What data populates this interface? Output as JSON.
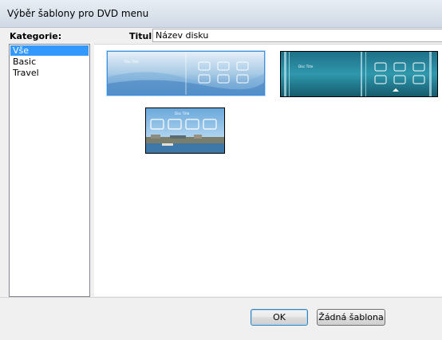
{
  "window": {
    "title": "Výběr šablony pro DVD menu"
  },
  "categories": {
    "label": "Kategorie:",
    "items": [
      {
        "label": "Vše",
        "selected": true
      },
      {
        "label": "Basic",
        "selected": false
      },
      {
        "label": "Travel",
        "selected": false
      }
    ]
  },
  "title_field": {
    "label": "Titul:",
    "value": "Název disku"
  },
  "templates": [
    {
      "name": "light-blue-template",
      "selected": true,
      "thumb_title": "Title Title"
    },
    {
      "name": "teal-template",
      "selected": false,
      "thumb_title": "Disc Title"
    },
    {
      "name": "travel-harbor-template",
      "selected": false,
      "thumb_title": "Disc Title"
    }
  ],
  "buttons": {
    "ok": "OK",
    "no_template": "Žádná šablona"
  },
  "colors": {
    "selection": "#3399ff",
    "default_button_border": "#3c7fb1"
  }
}
